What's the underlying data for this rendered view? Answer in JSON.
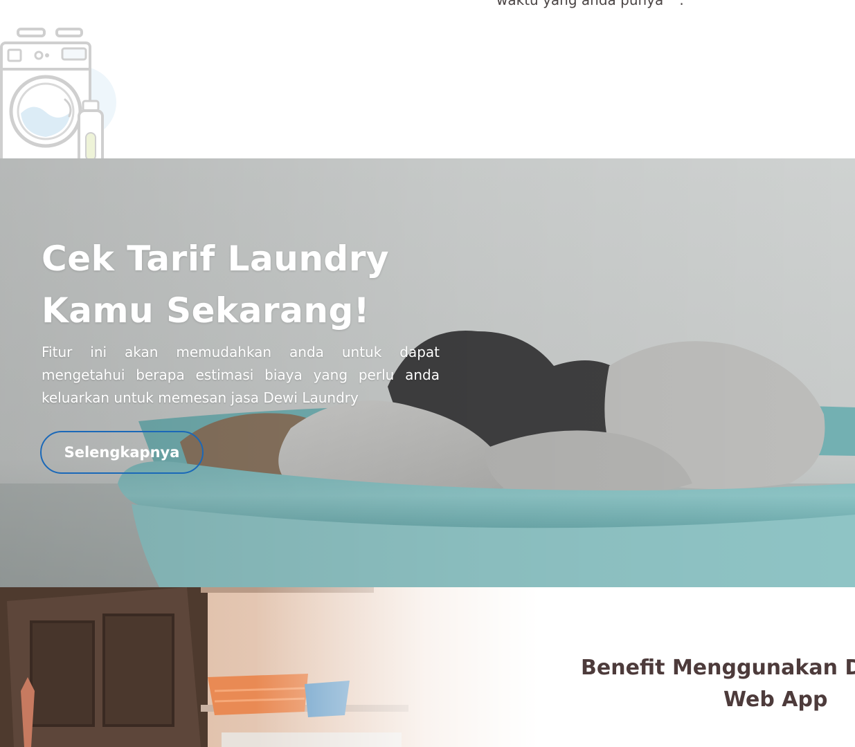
{
  "top": {
    "caption": "waktu yang anda punya ^.^",
    "illustration_icon": "washing-machine-icon"
  },
  "hero": {
    "title_line1": "Cek Tarif Laundry",
    "title_line2": "Kamu Sekarang!",
    "description": "Fitur ini akan memudahkan anda untuk dapat mengetahui berapa estimasi biaya yang perlu anda keluarkan untuk memesan jasa Dewi Laundry",
    "button_label": "Selengkapnya",
    "button_border_color": "#1a68b8",
    "background_photo": "laundry-basket-photo"
  },
  "benefit": {
    "title_line1": "Benefit Menggunakan Dewi Laundry",
    "title_line2": "Web App",
    "title_color": "#4d3b3b",
    "photo": "laundry-room-photo"
  }
}
